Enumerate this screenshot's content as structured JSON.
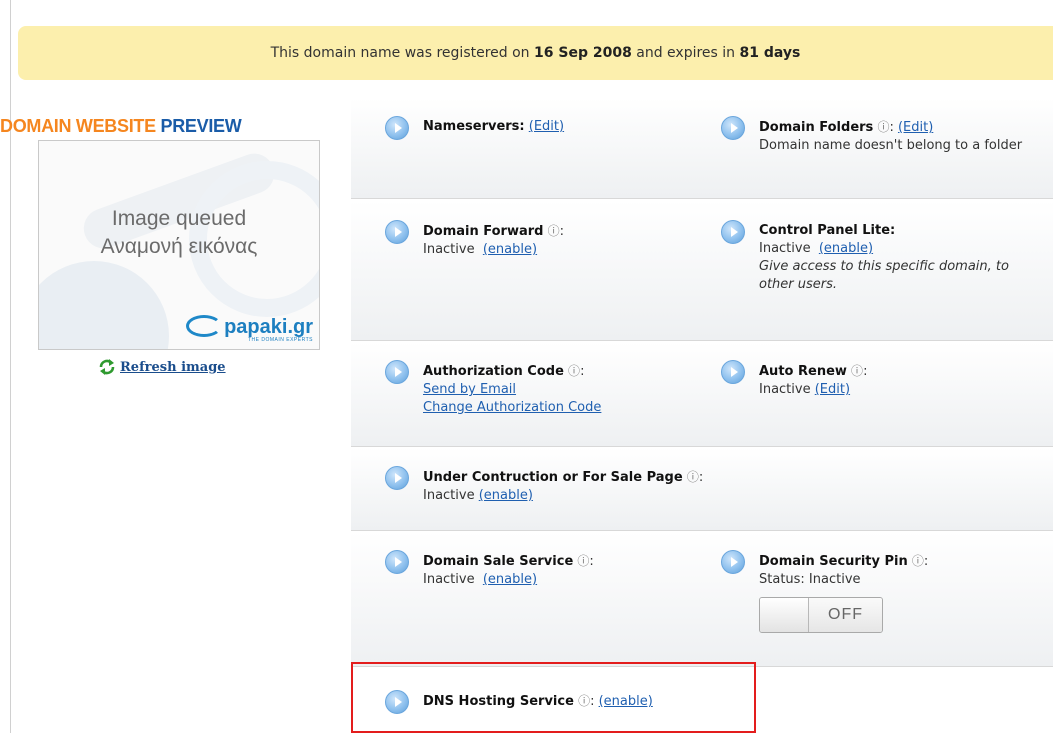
{
  "banner": {
    "prefix": "This domain name was registered on ",
    "date": "16 Sep 2008",
    "middle": " and expires in ",
    "days": "81 days"
  },
  "preview": {
    "title_part1": "DOMAIN WEBSITE",
    "title_part2": "PREVIEW",
    "line1": "Image queued",
    "line2": "Αναμονή εικόνας",
    "logo_text": "papaki.gr",
    "logo_tagline": "THE DOMAIN EXPERTS",
    "refresh_label": "Refresh image"
  },
  "info_icon": "ⓘ",
  "sections": {
    "nameservers": {
      "label": "Nameservers:",
      "action": "(Edit)"
    },
    "domain_folders": {
      "label": "Domain Folders",
      "action": "(Edit)",
      "description": "Domain name doesn't belong to a folder"
    },
    "domain_forward": {
      "label": "Domain Forward",
      "status": "Inactive",
      "action": "(enable)"
    },
    "control_panel_lite": {
      "label": "Control Panel Lite:",
      "status": "Inactive",
      "action": "(enable)",
      "note": "Give access to this specific domain, to other users."
    },
    "authorization_code": {
      "label": "Authorization Code",
      "link1": "Send by Email",
      "link2": "Change Authorization Code"
    },
    "auto_renew": {
      "label": "Auto Renew",
      "status": "Inactive",
      "action": "(Edit)"
    },
    "under_construction": {
      "label": "Under Contruction or For Sale Page",
      "status": "Inactive",
      "action": "(enable)"
    },
    "domain_sale": {
      "label": "Domain Sale Service",
      "status": "Inactive",
      "action": "(enable)"
    },
    "security_pin": {
      "label": "Domain Security Pin",
      "status": "Status: Inactive",
      "toggle": "OFF"
    },
    "dns_hosting": {
      "label": "DNS Hosting Service",
      "action": "(enable)"
    }
  },
  "colors": {
    "banner_bg": "#fcefad",
    "title_orange": "#f5861f",
    "title_blue": "#1a5ca8",
    "link": "#1f5fb0",
    "highlight": "#e31d1d"
  }
}
